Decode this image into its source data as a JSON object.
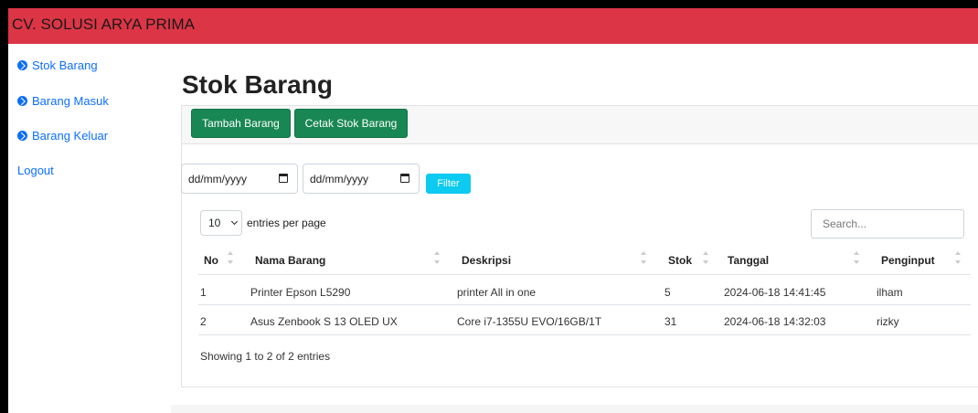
{
  "app": {
    "brand": "CV. SOLUSI ARYA PRIMA"
  },
  "sidebar": {
    "items": [
      {
        "label": "Stok Barang",
        "icon": "circle-arrow-icon"
      },
      {
        "label": "Barang Masuk",
        "icon": "circle-arrow-icon"
      },
      {
        "label": "Barang Keluar",
        "icon": "circle-arrow-icon"
      }
    ],
    "logout": "Logout"
  },
  "main": {
    "title": "Stok Barang",
    "buttons": {
      "add": "Tambah Barang",
      "print": "Cetak Stok Barang"
    },
    "filter": {
      "date_from": "dd/mm/yyyy",
      "date_to": "dd/mm/yyyy",
      "button": "Filter"
    },
    "table_controls": {
      "per_page_value": "10",
      "per_page_label": "entries per page",
      "search_placeholder": "Search..."
    },
    "table": {
      "headers": [
        "No",
        "Nama Barang",
        "Deskripsi",
        "Stok",
        "Tanggal",
        "Penginput"
      ],
      "rows": [
        [
          "1",
          "Printer Epson L5290",
          "printer All in one",
          "5",
          "2024-06-18 14:41:45",
          "ilham"
        ],
        [
          "2",
          "Asus Zenbook S 13 OLED UX",
          "Core i7-1355U EVO/16GB/1T",
          "31",
          "2024-06-18 14:32:03",
          "rizky"
        ]
      ]
    },
    "info": "Showing 1 to 2 of 2 entries"
  },
  "colors": {
    "topbar": "#dc3545",
    "primary": "#0d6efd",
    "success": "#198754",
    "info": "#0dcaf0"
  }
}
